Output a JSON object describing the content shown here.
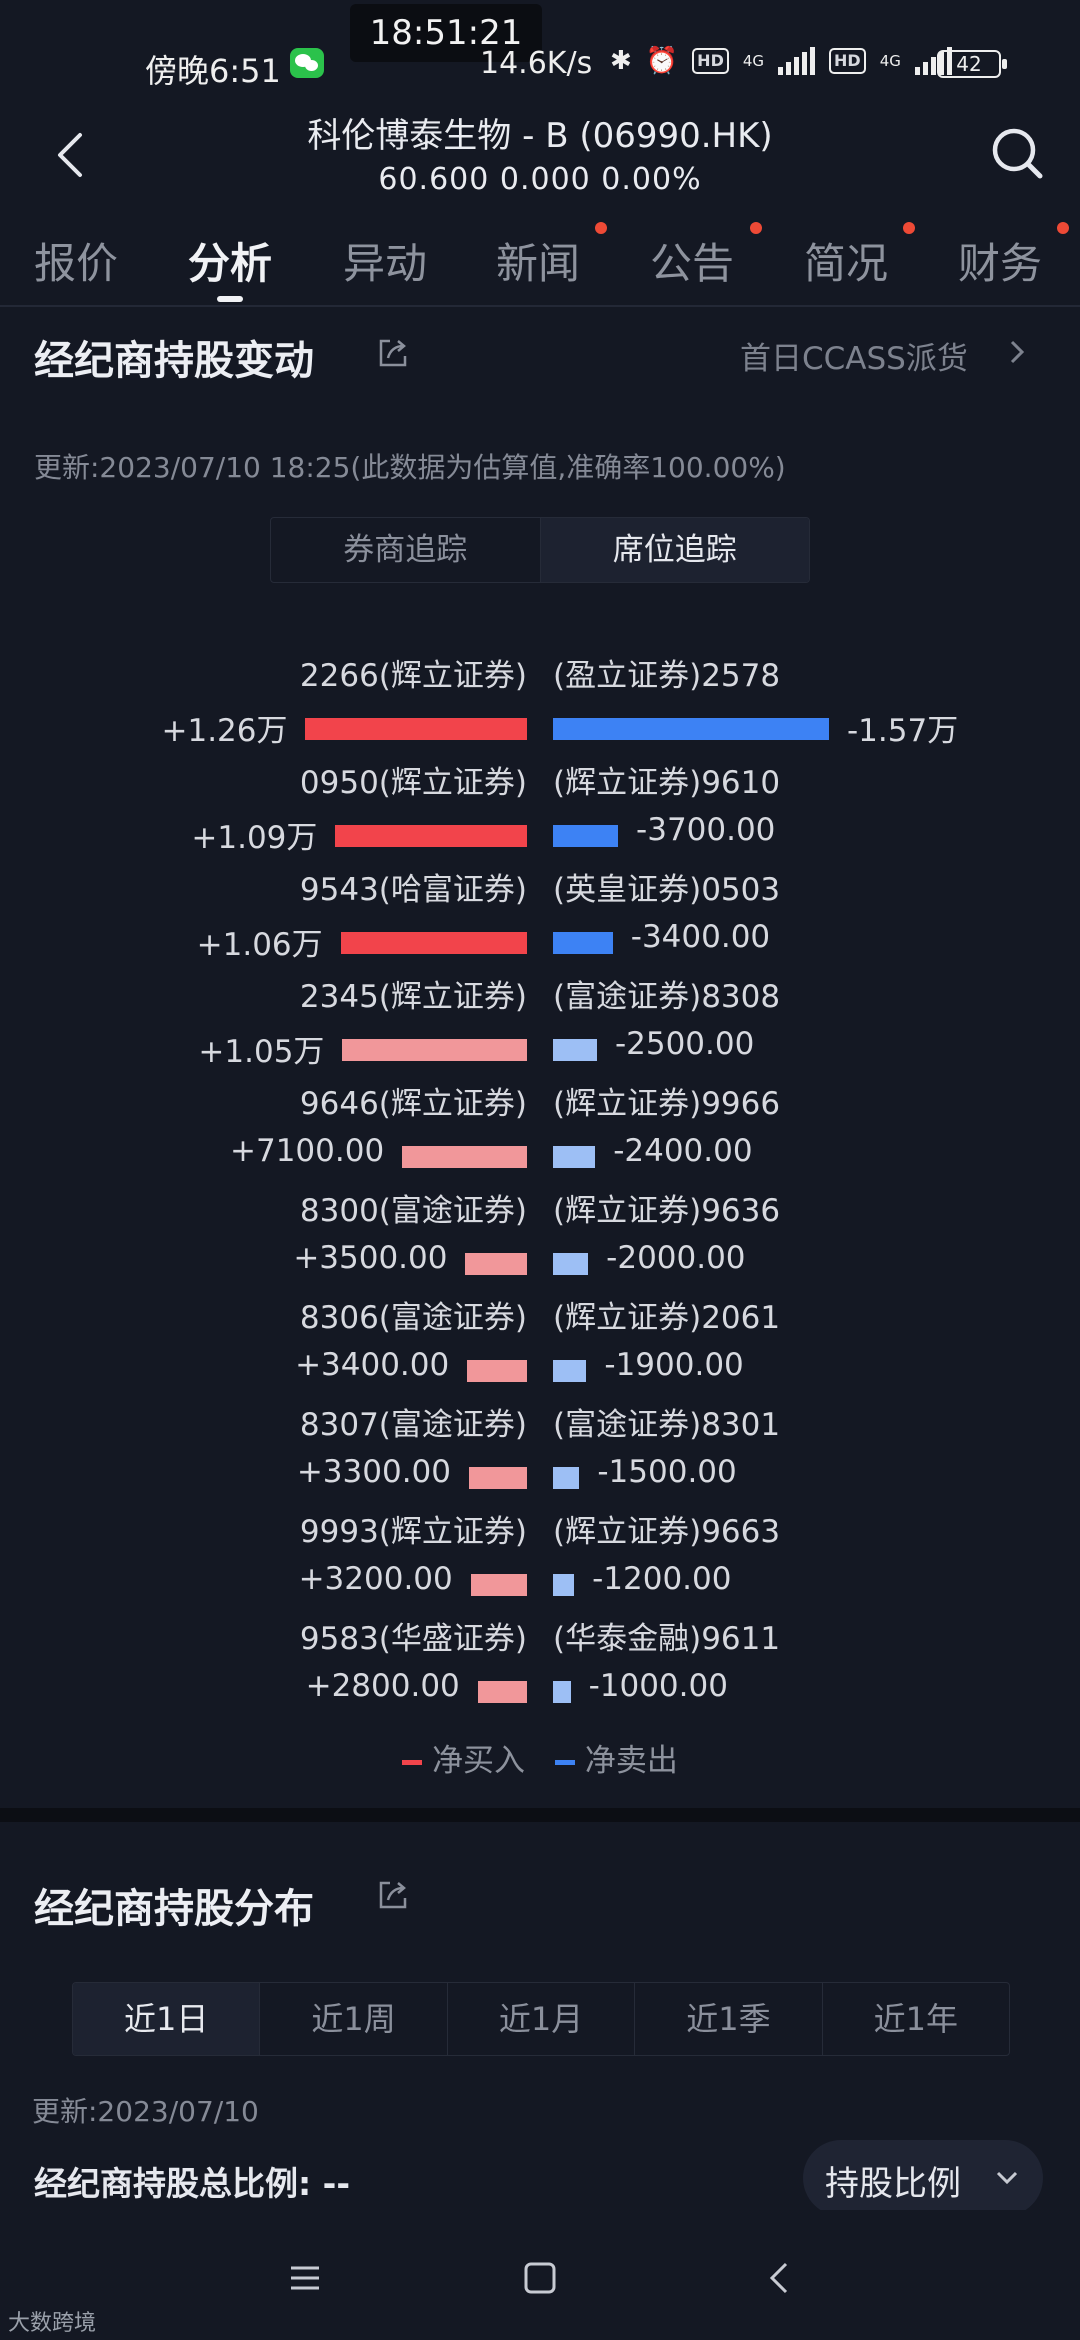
{
  "status_bar": {
    "clock": "18:51:21",
    "time_left": "傍晚6:51",
    "net_speed": "14.6K/s",
    "net_4g_1": "4G",
    "net_4g_2": "4G",
    "hd_1": "HD",
    "hd_2": "HD",
    "battery": "42"
  },
  "header": {
    "title": "科伦博泰生物 - B (06990.HK)",
    "price_line": "60.600  0.000  0.00%"
  },
  "tabs": [
    {
      "label": "报价",
      "active": false,
      "dot": false
    },
    {
      "label": "分析",
      "active": true,
      "dot": false
    },
    {
      "label": "异动",
      "active": false,
      "dot": false
    },
    {
      "label": "新闻",
      "active": false,
      "dot": true
    },
    {
      "label": "公告",
      "active": false,
      "dot": true
    },
    {
      "label": "简况",
      "active": false,
      "dot": true
    },
    {
      "label": "财务",
      "active": false,
      "dot": true
    }
  ],
  "section1": {
    "title": "经纪商持股变动",
    "ccass_link": "首日CCASS派货",
    "update": "更新:2023/07/10 18:25(此数据为估算值,准确率100.00%)",
    "segments": [
      {
        "label": "券商追踪",
        "active": false
      },
      {
        "label": "席位追踪",
        "active": true
      }
    ],
    "legend_buy": "净买入",
    "legend_sell": "净卖出"
  },
  "chart_data": {
    "type": "bar",
    "buy_series": {
      "name": "净买入",
      "categories": [
        "2266(辉立证券)",
        "0950(辉立证券)",
        "9543(哈富证券)",
        "2345(辉立证券)",
        "9646(辉立证券)",
        "8300(富途证券)",
        "8306(富途证券)",
        "8307(富途证券)",
        "9993(辉立证券)",
        "9583(华盛证券)"
      ],
      "values": [
        12600,
        10900,
        10600,
        10500,
        7100,
        3500,
        3400,
        3300,
        3200,
        2800
      ],
      "labels": [
        "+1.26万",
        "+1.09万",
        "+1.06万",
        "+1.05万",
        "+7100.00",
        "+3500.00",
        "+3400.00",
        "+3300.00",
        "+3200.00",
        "+2800.00"
      ]
    },
    "sell_series": {
      "name": "净卖出",
      "categories": [
        "(盈立证券)2578",
        "(辉立证券)9610",
        "(英皇证券)0503",
        "(富途证券)8308",
        "(辉立证券)9966",
        "(辉立证券)9636",
        "(辉立证券)2061",
        "(富途证券)8301",
        "(辉立证券)9663",
        "(华泰金融)9611"
      ],
      "values": [
        15700,
        3700,
        3400,
        2500,
        2400,
        2000,
        1900,
        1500,
        1200,
        1000
      ],
      "labels": [
        "-1.57万",
        "-3700.00",
        "-3400.00",
        "-2500.00",
        "-2400.00",
        "-2000.00",
        "-1900.00",
        "-1500.00",
        "-1200.00",
        "-1000.00"
      ]
    }
  },
  "colors": {
    "buy_strong": "#f2444b",
    "buy_light": "#f1979a",
    "sell_strong": "#3d82f4",
    "sell_light": "#9dbff5"
  },
  "section2": {
    "title": "经纪商持股分布",
    "periods": [
      {
        "label": "近1日",
        "active": true
      },
      {
        "label": "近1周",
        "active": false
      },
      {
        "label": "近1月",
        "active": false
      },
      {
        "label": "近1季",
        "active": false
      },
      {
        "label": "近1年",
        "active": false
      }
    ],
    "update": "更新:2023/07/10",
    "ratio_label": "经纪商持股总比例: --",
    "dropdown_label": "持股比例"
  },
  "watermark": "大数跨境"
}
